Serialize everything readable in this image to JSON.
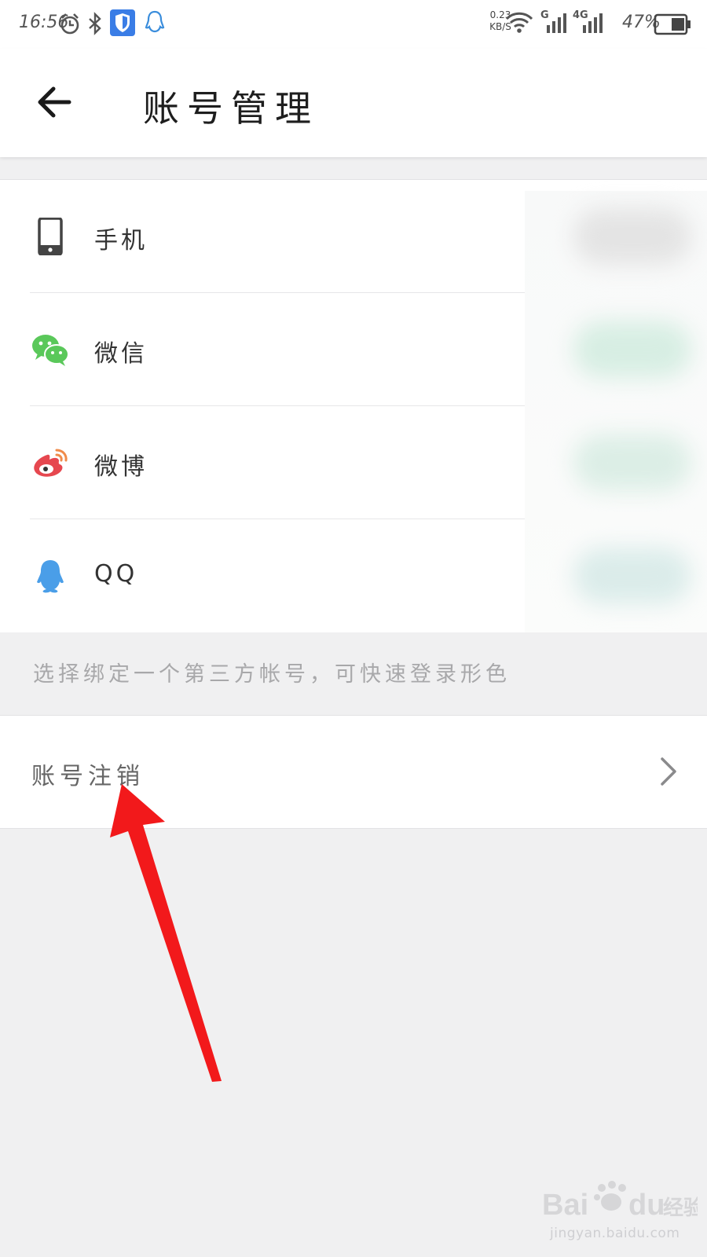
{
  "status_bar": {
    "time": "16:56",
    "net_speed": "0.23",
    "net_speed_unit": "KB/S",
    "signal_label_1": "G",
    "signal_label_2": "4G",
    "battery": "47%"
  },
  "header": {
    "title": "账号管理"
  },
  "accounts": [
    {
      "label": "手机",
      "icon": "phone-icon",
      "color": "#444444"
    },
    {
      "label": "微信",
      "icon": "wechat-icon",
      "color": "#5ac85a"
    },
    {
      "label": "微博",
      "icon": "weibo-icon",
      "color": "#e6474f"
    },
    {
      "label": "QQ",
      "icon": "qq-icon",
      "color": "#4a9ee8"
    }
  ],
  "hint": "选择绑定一个第三方帐号，可快速登录形色",
  "deactivate": {
    "label": "账号注销",
    "icon": "chevron-right-icon"
  },
  "colors": {
    "annotation_arrow": "#f2191b",
    "background": "#f0f0f1"
  },
  "watermark": {
    "brand": "Bai",
    "brand_suffix": "du",
    "product": "经验",
    "url": "jingyan.baidu.com"
  }
}
